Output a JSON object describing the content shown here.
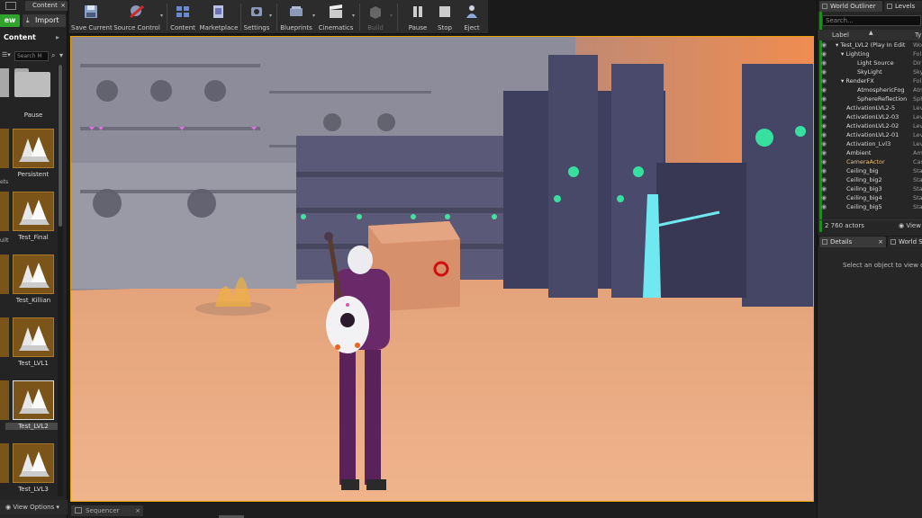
{
  "content_browser": {
    "tab_label": "Content",
    "new_label": "Add New",
    "new_visible": "ew",
    "import_label": "Import",
    "path_label": "Content",
    "search_placeholder": "Search M",
    "view_options_label": "View Options",
    "folder_label": "Pause",
    "assets": [
      {
        "label": "Persistent",
        "selected": false
      },
      {
        "label": "Test_Final",
        "selected": false
      },
      {
        "label": "Test_Killian",
        "selected": false
      },
      {
        "label": "Test_LVL1",
        "selected": false
      },
      {
        "label": "Test_LVL2",
        "selected": true
      },
      {
        "label": "Test_LVL3",
        "selected": false
      }
    ],
    "cut_labels": [
      "ets",
      "uilt"
    ]
  },
  "toolbar": {
    "buttons": [
      {
        "label": "Save Current",
        "icon": "save-icon",
        "color": "#8aa0c8"
      },
      {
        "label": "Source Control",
        "icon": "source-control-icon",
        "color": "#c03030"
      },
      {
        "label": "Content",
        "icon": "content-icon",
        "color": "#6a8ad0"
      },
      {
        "label": "Marketplace",
        "icon": "marketplace-icon",
        "color": "#8c8cc8"
      },
      {
        "label": "Settings",
        "icon": "settings-icon",
        "color": "#8a9ab8"
      },
      {
        "label": "Blueprints",
        "icon": "blueprints-icon",
        "color": "#8a9ab8"
      },
      {
        "label": "Cinematics",
        "icon": "cinematics-icon",
        "color": "#bbbbbb"
      },
      {
        "label": "Build",
        "icon": "build-icon",
        "color": "#777777",
        "disabled": true
      },
      {
        "label": "Pause",
        "icon": "pause-icon",
        "color": "#bbbbbb"
      },
      {
        "label": "Stop",
        "icon": "stop-icon",
        "color": "#bbbbbb"
      },
      {
        "label": "Eject",
        "icon": "eject-icon",
        "color": "#88aadd"
      }
    ]
  },
  "bottom": {
    "sequencer_tab": "Sequencer"
  },
  "world_outliner": {
    "tab_label": "World Outliner",
    "levels_tab": "Levels",
    "search_placeholder": "Search...",
    "col_label": "Label",
    "col_type": "Ty",
    "rows": [
      {
        "name": "Test_LVL2 (Play In Edit",
        "type": "Wo",
        "indent": 1,
        "icon": "world-icon"
      },
      {
        "name": "Lighting",
        "type": "Fol",
        "indent": 2,
        "icon": "folder-icon"
      },
      {
        "name": "Light Source",
        "type": "Dir",
        "indent": 3,
        "icon": "light-icon"
      },
      {
        "name": "SkyLight",
        "type": "Sky",
        "indent": 3,
        "icon": "light-icon"
      },
      {
        "name": "RenderFX",
        "type": "Fol",
        "indent": 2,
        "icon": "folder-icon"
      },
      {
        "name": "AtmosphericFog",
        "type": "Atm",
        "indent": 3,
        "icon": "fog-icon"
      },
      {
        "name": "SphereReflection",
        "type": "Sph",
        "indent": 3,
        "icon": "sphere-icon"
      },
      {
        "name": "ActivationLVL2-5",
        "type": "Lev",
        "indent": 2,
        "icon": "actor-icon"
      },
      {
        "name": "ActivationLVL2-03",
        "type": "Lev",
        "indent": 2,
        "icon": "actor-icon"
      },
      {
        "name": "ActivationLVL2-02",
        "type": "Lev",
        "indent": 2,
        "icon": "actor-icon"
      },
      {
        "name": "ActivationLVL2-01",
        "type": "Lev",
        "indent": 2,
        "icon": "actor-icon"
      },
      {
        "name": "Activation_Lvl3",
        "type": "Lev",
        "indent": 2,
        "icon": "actor-icon"
      },
      {
        "name": "Ambient",
        "type": "Am",
        "indent": 2,
        "icon": "sound-icon"
      },
      {
        "name": "CameraActor",
        "type": "Cas",
        "indent": 2,
        "icon": "camera-icon"
      },
      {
        "name": "Ceiling_big",
        "type": "Sta",
        "indent": 2,
        "icon": "mesh-icon"
      },
      {
        "name": "Ceiling_big2",
        "type": "Sta",
        "indent": 2,
        "icon": "mesh-icon"
      },
      {
        "name": "Ceiling_big3",
        "type": "Sta",
        "indent": 2,
        "icon": "mesh-icon"
      },
      {
        "name": "Ceiling_big4",
        "type": "Sta",
        "indent": 2,
        "icon": "mesh-icon"
      },
      {
        "name": "Ceiling_big5",
        "type": "Sta",
        "indent": 2,
        "icon": "mesh-icon"
      }
    ],
    "actor_count": "2 760 actors",
    "view_label": "View"
  },
  "details": {
    "tab_label": "Details",
    "world_settings_tab": "World S",
    "empty_message": "Select an object to view deta"
  },
  "colors": {
    "accent_green": "#2fa32c",
    "viewport_border": "#e8a000",
    "asset_thumb": "#7a5418"
  }
}
